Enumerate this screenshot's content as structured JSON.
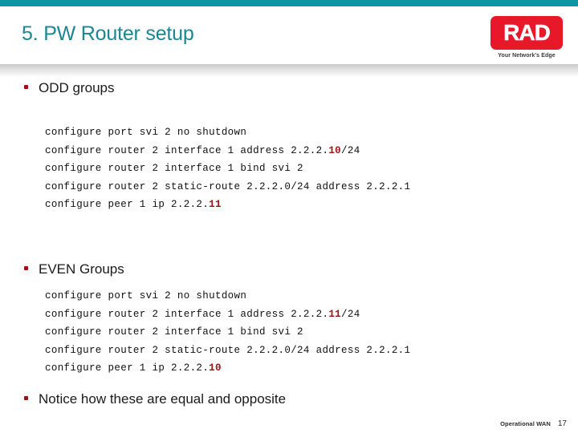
{
  "slide": {
    "title": "5. PW Router setup",
    "accent_teal": "#0c95a2",
    "title_color": "#1b8792",
    "bullet_color": "#9d1111",
    "highlight_color": "#a11212"
  },
  "logo": {
    "name": "RAD",
    "tagline": "Your Network's Edge",
    "box_color": "#e8172a"
  },
  "sections": {
    "odd": {
      "heading": "ODD groups",
      "lines": [
        {
          "pre": "configure port svi 2 no shutdown",
          "hl": "",
          "post": ""
        },
        {
          "pre": "configure router 2 interface 1 address 2.2.2.",
          "hl": "10",
          "post": "/24"
        },
        {
          "pre": "configure router 2 interface 1 bind svi 2",
          "hl": "",
          "post": ""
        },
        {
          "pre": "configure router 2 static-route 2.2.2.0/24 address 2.2.2.1",
          "hl": "",
          "post": ""
        },
        {
          "pre": "configure peer 1 ip 2.2.2.",
          "hl": "11",
          "post": ""
        }
      ]
    },
    "even": {
      "heading": "EVEN Groups",
      "lines": [
        {
          "pre": "configure port svi 2 no shutdown",
          "hl": "",
          "post": ""
        },
        {
          "pre": "configure router 2 interface 1 address 2.2.2.",
          "hl": "11",
          "post": "/24"
        },
        {
          "pre": "configure router 2 interface 1 bind svi 2",
          "hl": "",
          "post": ""
        },
        {
          "pre": "configure router 2 static-route 2.2.2.0/24 address 2.2.2.1",
          "hl": "",
          "post": ""
        },
        {
          "pre": "configure peer 1 ip 2.2.2.",
          "hl": "10",
          "post": ""
        }
      ]
    },
    "note": {
      "heading": "Notice how these are equal and opposite"
    }
  },
  "footer": {
    "label": "Operational WAN",
    "page": "17"
  }
}
